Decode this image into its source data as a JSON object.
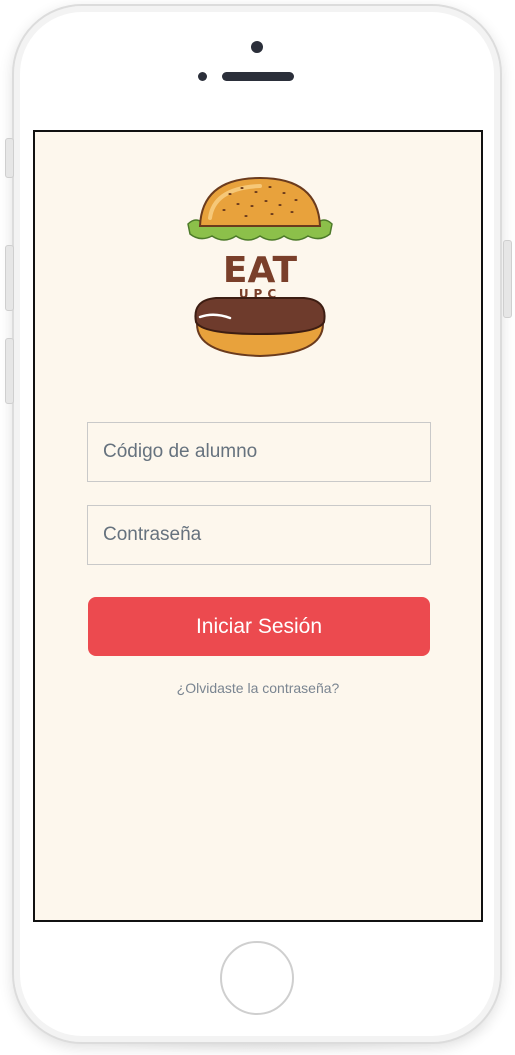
{
  "app": {
    "logo_text": "EAT",
    "logo_subtext": "UPC"
  },
  "login": {
    "code_placeholder": "Código de alumno",
    "password_placeholder": "Contraseña",
    "submit_label": "Iniciar Sesión",
    "forgot_label": "¿Olvidaste la contraseña?"
  },
  "colors": {
    "screen_background": "#fdf7ed",
    "primary_button": "#ec4a4f",
    "logo_brown": "#7a3f2a",
    "bun_orange": "#e8a23c",
    "lettuce_green": "#8cc04a"
  },
  "icons": {
    "logo": "burger-logo-icon"
  }
}
